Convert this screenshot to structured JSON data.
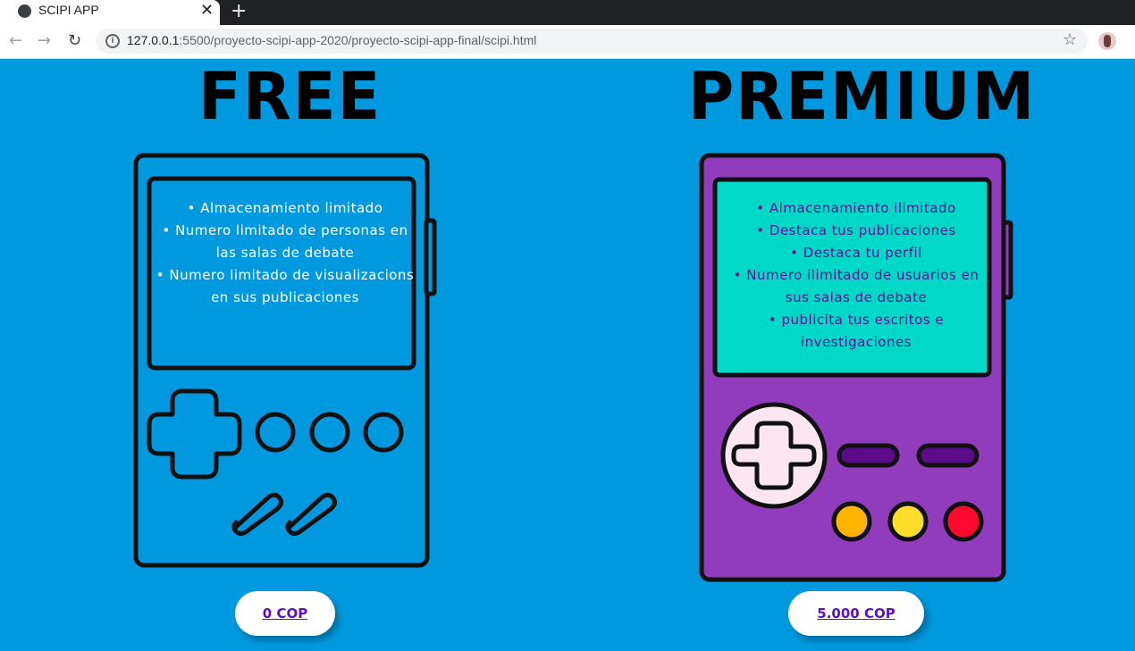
{
  "browser": {
    "tab_title": "SCIPI APP",
    "close_glyph": "✕",
    "new_tab_glyph": "+",
    "url_host": "127.0.0.1",
    "url_rest": ":5500/proyecto-scipi-app-2020/proyecto-scipi-app-final/scipi.html",
    "back_glyph": "←",
    "forward_glyph": "→",
    "reload_glyph": "↻",
    "star_glyph": "☆"
  },
  "free": {
    "title": "FREE",
    "features": [
      "Almacenamiento limitado",
      "Numero limitado de personas en las salas de debate",
      "Numero limitado de visualizacions en sus publicaciones"
    ],
    "price": "0 COP",
    "colors": {
      "body": "#0099e0",
      "screen": "#0099e0",
      "text": "#ffffff"
    }
  },
  "premium": {
    "title": "PREMIUM",
    "features": [
      "Almacenamiento ilimitado",
      "Destaca tus publicaciones",
      "Destaca tu perfil",
      "Numero ilimitado de usuarios en sus salas de debate",
      "publicita tus escritos e investigaciones"
    ],
    "price": "5.000 COP",
    "colors": {
      "body": "#913cbd",
      "screen": "#00d8c8",
      "text": "#5b1590",
      "dpad_bg": "#fde6f0",
      "pill": "#5b0a8a",
      "btn_a": "#ffb400",
      "btn_b": "#ffdd2a",
      "btn_c": "#ff0a2e"
    }
  }
}
